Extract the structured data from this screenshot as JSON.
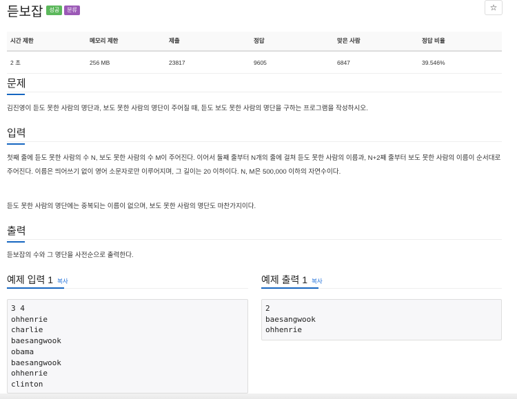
{
  "problem": {
    "title": "듣보잡",
    "badges": {
      "success": "성공",
      "category": "분류"
    },
    "star_label": "☆"
  },
  "stats": {
    "headers": [
      "시간 제한",
      "메모리 제한",
      "제출",
      "정답",
      "맞은 사람",
      "정답 비율"
    ],
    "values": [
      "2 초",
      "256 MB",
      "23817",
      "9605",
      "6847",
      "39.546%"
    ]
  },
  "sections": {
    "description": {
      "heading": "문제",
      "text": "김진영이 듣도 못한 사람의 명단과, 보도 못한 사람의 명단이 주어질 때, 듣도 보도 못한 사람의 명단을 구하는 프로그램을 작성하시오."
    },
    "input": {
      "heading": "입력",
      "text1": "첫째 줄에 듣도 못한 사람의 수 N, 보도 못한 사람의 수 M이 주어진다. 이어서 둘째 줄부터 N개의 줄에 걸쳐 듣도 못한 사람의 이름과, N+2째 줄부터 보도 못한 사람의 이름이 순서대로 주어진다. 이름은 띄어쓰기 없이 영어 소문자로만 이루어지며, 그 길이는 20 이하이다. N, M은 500,000 이하의 자연수이다.",
      "text2": "듣도 못한 사람의 명단에는 중복되는 이름이 없으며, 보도 못한 사람의 명단도 마찬가지이다."
    },
    "output": {
      "heading": "출력",
      "text": "듣보잡의 수와 그 명단을 사전순으로 출력한다."
    }
  },
  "samples": {
    "input": {
      "heading": "예제 입력 1",
      "copy": "복사",
      "content": "3 4\nohhenrie\ncharlie\nbaesangwook\nobama\nbaesangwook\nohhenrie\nclinton"
    },
    "output": {
      "heading": "예제 출력 1",
      "copy": "복사",
      "content": "2\nbaesangwook\nohhenrie"
    }
  }
}
